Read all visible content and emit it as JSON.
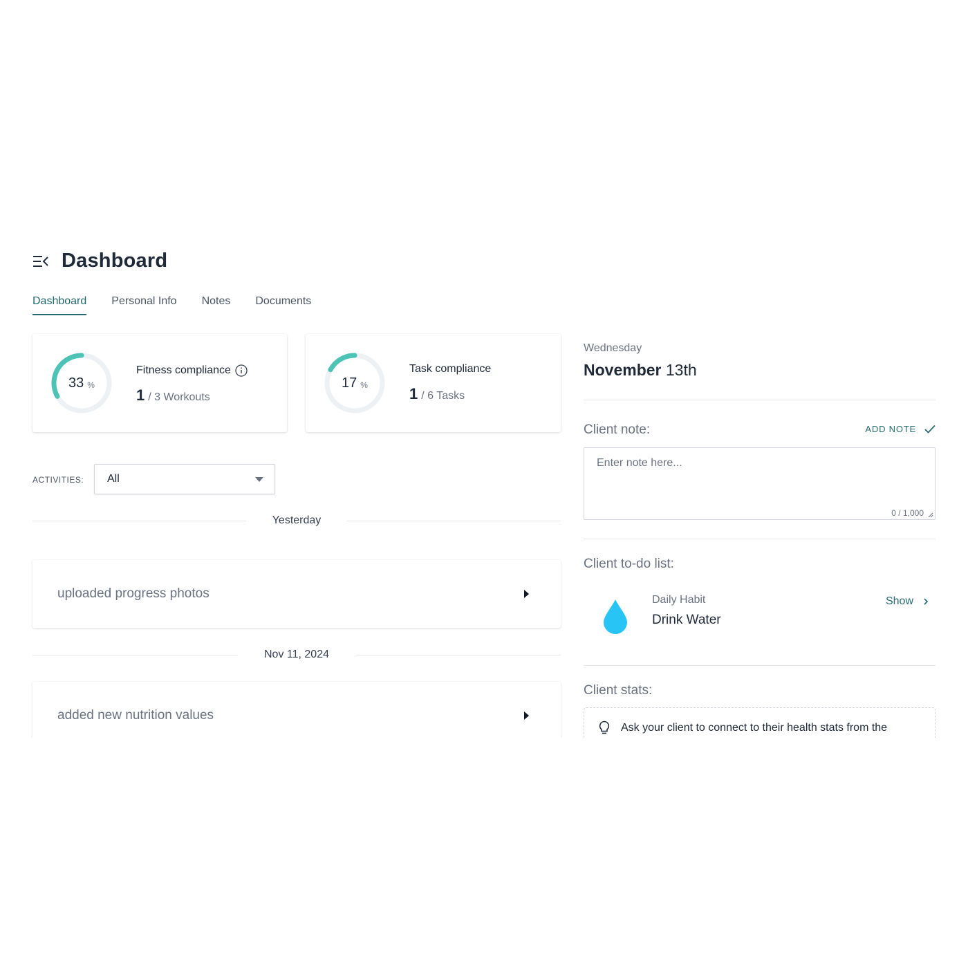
{
  "header": {
    "title": "Dashboard"
  },
  "tabs": [
    {
      "label": "Dashboard",
      "active": true
    },
    {
      "label": "Personal Info",
      "active": false
    },
    {
      "label": "Notes",
      "active": false
    },
    {
      "label": "Documents",
      "active": false
    }
  ],
  "fitness": {
    "title": "Fitness compliance",
    "percent": "33",
    "percent_unit": "%",
    "completed": "1",
    "total_text": "/ 3 Workouts",
    "fraction": 0.33
  },
  "task": {
    "title": "Task compliance",
    "percent": "17",
    "percent_unit": "%",
    "completed": "1",
    "total_text": "/ 6 Tasks",
    "fraction": 0.17
  },
  "activities": {
    "label": "ACTIVITIES:",
    "selected": "All",
    "groups": [
      {
        "date": "Yesterday",
        "item": "uploaded progress photos"
      },
      {
        "date": "Nov 11, 2024",
        "item": "added new nutrition values"
      }
    ]
  },
  "right": {
    "weekday": "Wednesday",
    "month": "November",
    "day": "13th",
    "client_note_label": "Client note:",
    "add_note_label": "ADD NOTE",
    "note_placeholder": "Enter note here...",
    "note_count": "0 / 1,000",
    "todo_label": "Client to-do list:",
    "todo_sub": "Daily Habit",
    "todo_title": "Drink Water",
    "show_label": "Show",
    "stats_label": "Client stats:",
    "stats_text": "Ask your client to connect to their health stats from the"
  },
  "colors": {
    "accent": "#256a70",
    "gauge_fill": "#4cc3b5",
    "gauge_track": "#eef1f4",
    "water": "#29c4f6"
  }
}
